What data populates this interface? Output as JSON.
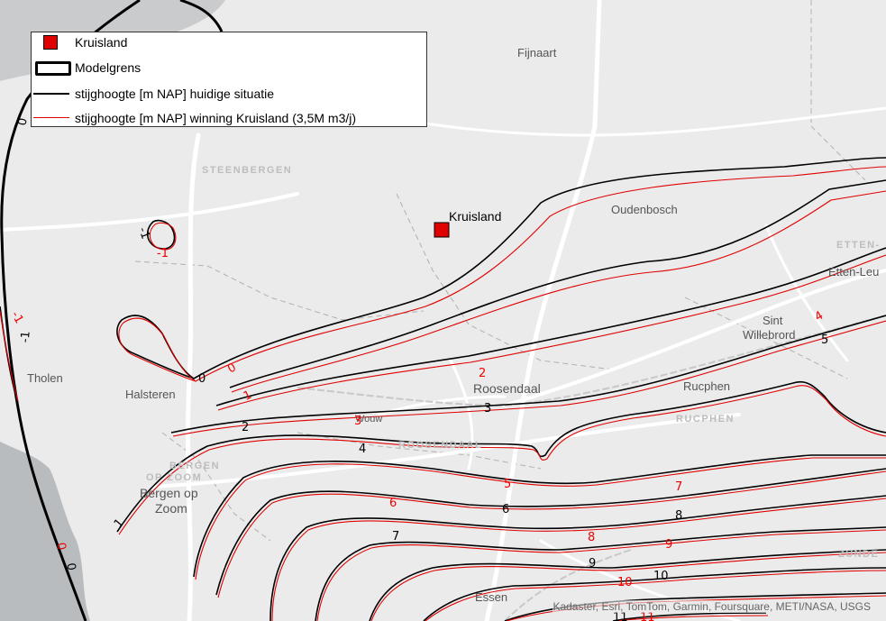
{
  "legend": {
    "items": [
      {
        "label": "Kruisland",
        "symbol": "red-square"
      },
      {
        "label": "Modelgrens",
        "symbol": "thick-black-outline"
      },
      {
        "label": "stijghoogte [m NAP] huidige situatie",
        "symbol": "black-line"
      },
      {
        "label": "stijghoogte [m NAP]  winning Kruisland (3,5M m3/j)",
        "symbol": "red-line"
      }
    ]
  },
  "site": {
    "label": "Kruisland",
    "color": "#e00000"
  },
  "places": {
    "fijnaart": "Fijnaart",
    "steenbergen": "STEENBERGEN",
    "oudenbosch": "Oudenbosch",
    "etten_region": "ETTEN-",
    "etten_leur": "Etten-Leu",
    "sint": "Sint",
    "willebrord": "Willebrord",
    "tholen": "Tholen",
    "halsteren": "Halsteren",
    "roosendaal": "Roosendaal",
    "rucphen": "Rucphen",
    "rucphen_region": "RUCPHEN",
    "wouw": "Wouw",
    "roosendaal_region": "ROOSENDAAL",
    "bergen_region_1": "BERGEN",
    "bergen_region_2": "OP ZOOM",
    "bergen_1": "Bergen op",
    "bergen_2": "Zoom",
    "essen": "Essen",
    "zunde": "ZUNDE"
  },
  "contour_labels": {
    "black": [
      "0",
      "-1",
      "0",
      "-1",
      "1",
      "2",
      "3",
      "4",
      "5",
      "6",
      "7",
      "8",
      "9",
      "10",
      "11",
      "0"
    ],
    "red": [
      "0",
      "-1",
      "1",
      "2",
      "3",
      "4",
      "5",
      "6",
      "7",
      "8",
      "9",
      "10",
      "11",
      "-1",
      "0"
    ]
  },
  "attribution": "Kadaster, Esri, TomTom, Garmin, Foursquare, METI/NASA, USGS",
  "colors": {
    "current": "#000000",
    "scenario": "#e00000",
    "water": "#b8bbbe",
    "land": "#ebebeb"
  }
}
